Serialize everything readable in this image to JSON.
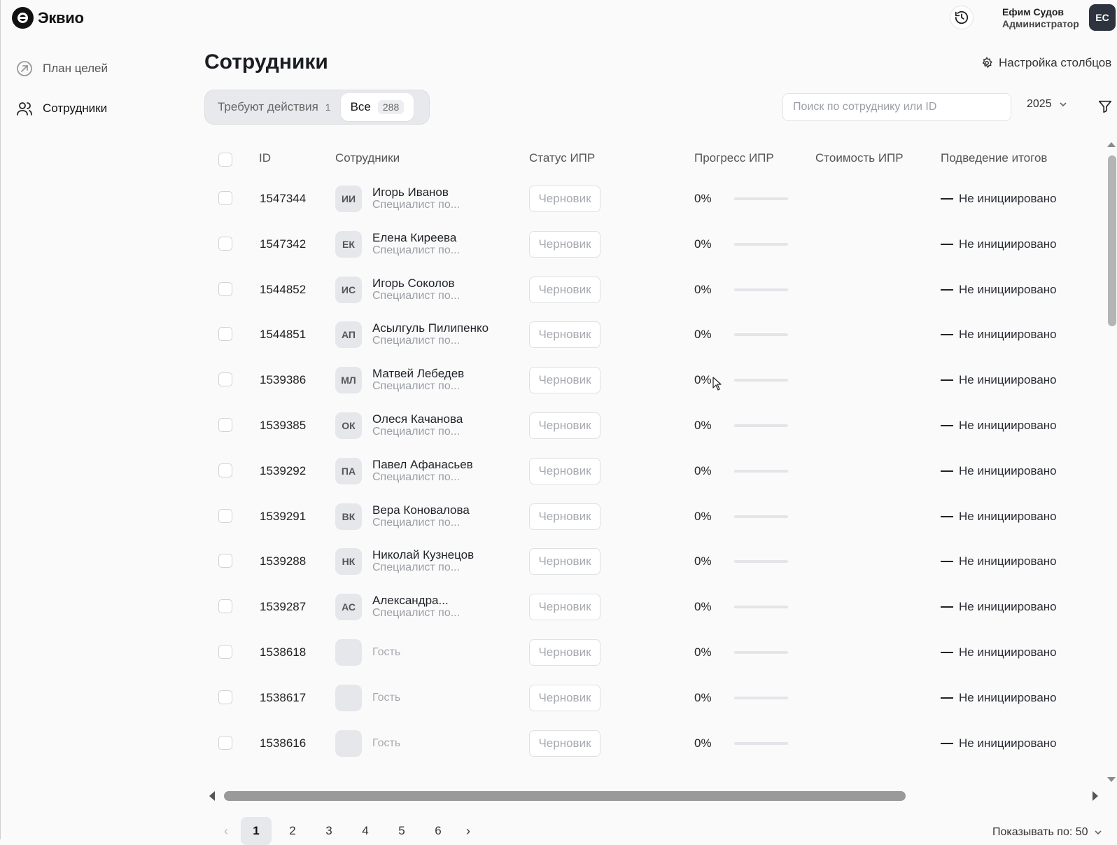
{
  "app": {
    "logo_text": "Эквио"
  },
  "header": {
    "user_name": "Ефим Судов",
    "user_role": "Администратор",
    "user_initials": "ЕС"
  },
  "sidebar": {
    "items": [
      {
        "label": "План целей",
        "icon": "target-arrow-icon"
      },
      {
        "label": "Сотрудники",
        "icon": "users-icon"
      }
    ]
  },
  "page": {
    "title": "Сотрудники",
    "columns_settings_label": "Настройка столбцов"
  },
  "segments": {
    "needs_action": {
      "label": "Требуют действия",
      "count": "1"
    },
    "all": {
      "label": "Все",
      "count": "288"
    }
  },
  "search": {
    "placeholder": "Поиск по сотруднику или ID",
    "value": ""
  },
  "year_filter": {
    "value": "2025"
  },
  "table": {
    "columns": [
      "ID",
      "Сотрудники",
      "Статус ИПР",
      "Прогресс ИПР",
      "Стоимость ИПР",
      "Подведение итогов"
    ],
    "rows": [
      {
        "id": "1547344",
        "initials": "ИИ",
        "name": "Игорь Иванов",
        "position": "Специалист по...",
        "status": "Черновик",
        "progress": "0%",
        "progress_value": 0,
        "cost": "",
        "result": "Не инициировано"
      },
      {
        "id": "1547342",
        "initials": "ЕК",
        "name": "Елена Киреева",
        "position": "Специалист по...",
        "status": "Черновик",
        "progress": "0%",
        "progress_value": 0,
        "cost": "",
        "result": "Не инициировано"
      },
      {
        "id": "1544852",
        "initials": "ИС",
        "name": "Игорь Соколов",
        "position": "Специалист по...",
        "status": "Черновик",
        "progress": "0%",
        "progress_value": 0,
        "cost": "",
        "result": "Не инициировано"
      },
      {
        "id": "1544851",
        "initials": "АП",
        "name": "Асылгуль Пилипенко",
        "position": "Специалист по...",
        "status": "Черновик",
        "progress": "0%",
        "progress_value": 0,
        "cost": "",
        "result": "Не инициировано"
      },
      {
        "id": "1539386",
        "initials": "МЛ",
        "name": "Матвей Лебедев",
        "position": "Специалист по...",
        "status": "Черновик",
        "progress": "0%",
        "progress_value": 0,
        "cost": "",
        "result": "Не инициировано"
      },
      {
        "id": "1539385",
        "initials": "ОК",
        "name": "Олеся Качанова",
        "position": "Специалист по...",
        "status": "Черновик",
        "progress": "0%",
        "progress_value": 0,
        "cost": "",
        "result": "Не инициировано"
      },
      {
        "id": "1539292",
        "initials": "ПА",
        "name": "Павел Афанасьев",
        "position": "Специалист по...",
        "status": "Черновик",
        "progress": "0%",
        "progress_value": 0,
        "cost": "",
        "result": "Не инициировано"
      },
      {
        "id": "1539291",
        "initials": "ВК",
        "name": "Вера Коновалова",
        "position": "Специалист по...",
        "status": "Черновик",
        "progress": "0%",
        "progress_value": 0,
        "cost": "",
        "result": "Не инициировано"
      },
      {
        "id": "1539288",
        "initials": "НК",
        "name": "Николай Кузнецов",
        "position": "Специалист по...",
        "status": "Черновик",
        "progress": "0%",
        "progress_value": 0,
        "cost": "",
        "result": "Не инициировано"
      },
      {
        "id": "1539287",
        "initials": "АС",
        "name": "Александра...",
        "position": "Специалист по...",
        "status": "Черновик",
        "progress": "0%",
        "progress_value": 0,
        "cost": "",
        "result": "Не инициировано"
      },
      {
        "id": "1538618",
        "initials": "",
        "name": "",
        "position": "",
        "guest": "Гость",
        "status": "Черновик",
        "progress": "0%",
        "progress_value": 0,
        "cost": "",
        "result": "Не инициировано"
      },
      {
        "id": "1538617",
        "initials": "",
        "name": "",
        "position": "",
        "guest": "Гость",
        "status": "Черновик",
        "progress": "0%",
        "progress_value": 0,
        "cost": "",
        "result": "Не инициировано"
      },
      {
        "id": "1538616",
        "initials": "",
        "name": "",
        "position": "",
        "guest": "Гость",
        "status": "Черновик",
        "progress": "0%",
        "progress_value": 0,
        "cost": "",
        "result": "Не инициировано"
      }
    ]
  },
  "pagination": {
    "pages": [
      "1",
      "2",
      "3",
      "4",
      "5",
      "6"
    ],
    "current": "1",
    "per_page_label": "Показывать по: 50"
  },
  "colors": {
    "accent": "#2d6bf4",
    "avatar_bg": "#2d3440"
  }
}
